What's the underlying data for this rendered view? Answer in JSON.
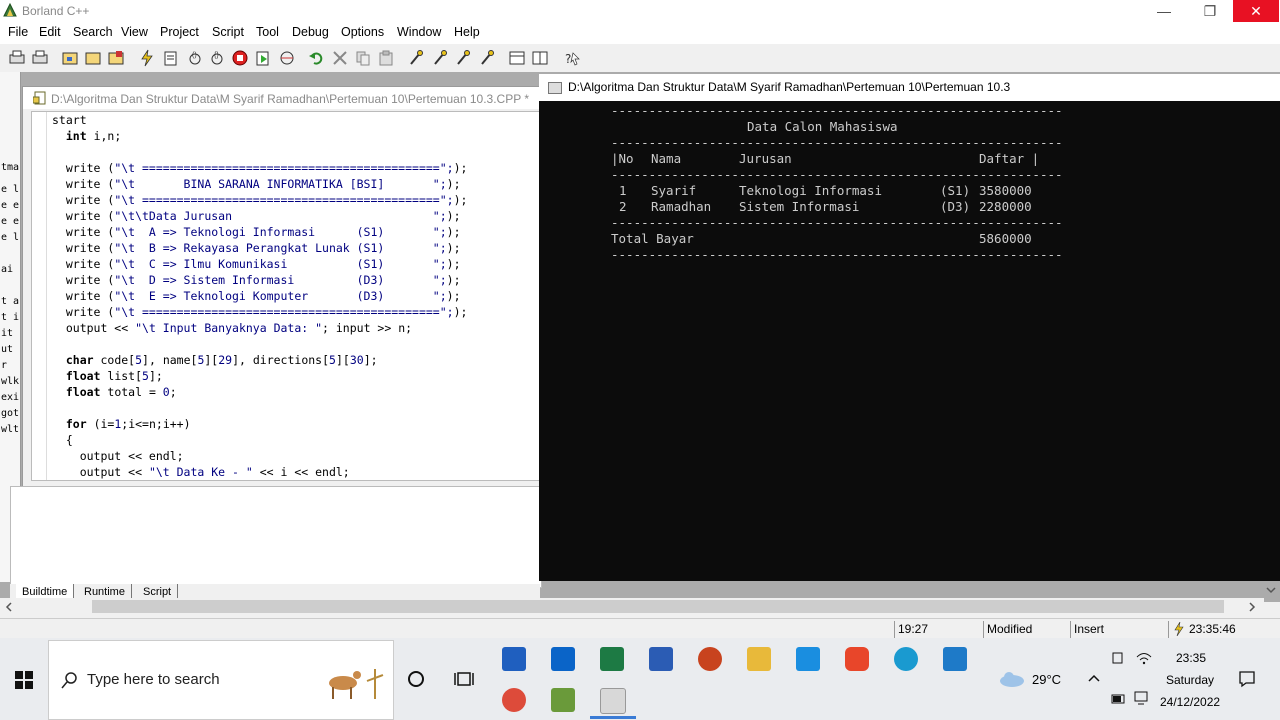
{
  "app": {
    "title": "Borland C++"
  },
  "window_controls": {
    "minimize": "—",
    "restore": "❐",
    "close": "✕"
  },
  "menu": [
    "File",
    "Edit",
    "Search",
    "View",
    "Project",
    "Script",
    "Tool",
    "Debug",
    "Options",
    "Window",
    "Help"
  ],
  "editor": {
    "title": "D:\\Algoritma Dan Struktur Data\\M Syarif Ramadhan\\Pertemuan 10\\Pertemuan 10.3.CPP *"
  },
  "left_dock_fragments": [
    "tma",
    "e l",
    "e e",
    "e e",
    "e l",
    "ai",
    "t a",
    "t i",
    "it",
    "ut",
    "r",
    "wlk",
    "exi",
    "got",
    "wlt"
  ],
  "bottom_tabs": [
    "Buildtime",
    "Runtime",
    "Script"
  ],
  "console": {
    "title": "D:\\Algoritma Dan Struktur Data\\M Syarif Ramadhan\\Pertemuan 10\\Pertemuan 10.3",
    "separator": "------------------------------------------------------------",
    "header_title": "Data Calon Mahasiswa",
    "col_no": "|No",
    "col_nama": "Nama",
    "col_jurusan": "Jurusan",
    "col_daftar": "Daftar |",
    "rows": [
      {
        "no": "1",
        "nama": "Syarif",
        "jurusan": "Teknologi Informasi",
        "kode": "(S1)",
        "daftar": "3580000"
      },
      {
        "no": "2",
        "nama": "Ramadhan",
        "jurusan": "Sistem Informasi",
        "kode": "(D3)",
        "daftar": "2280000"
      }
    ],
    "total_label": "Total Bayar",
    "total_value": "5860000"
  },
  "status": {
    "position": "19:27",
    "modified": "Modified",
    "mode": "Insert",
    "time": "23:35:46"
  },
  "taskbar": {
    "search_placeholder": "Type here to search",
    "weather": "29°C",
    "clock_time": "23:35",
    "clock_day": "Saturday",
    "clock_date": "24/12/2022"
  }
}
